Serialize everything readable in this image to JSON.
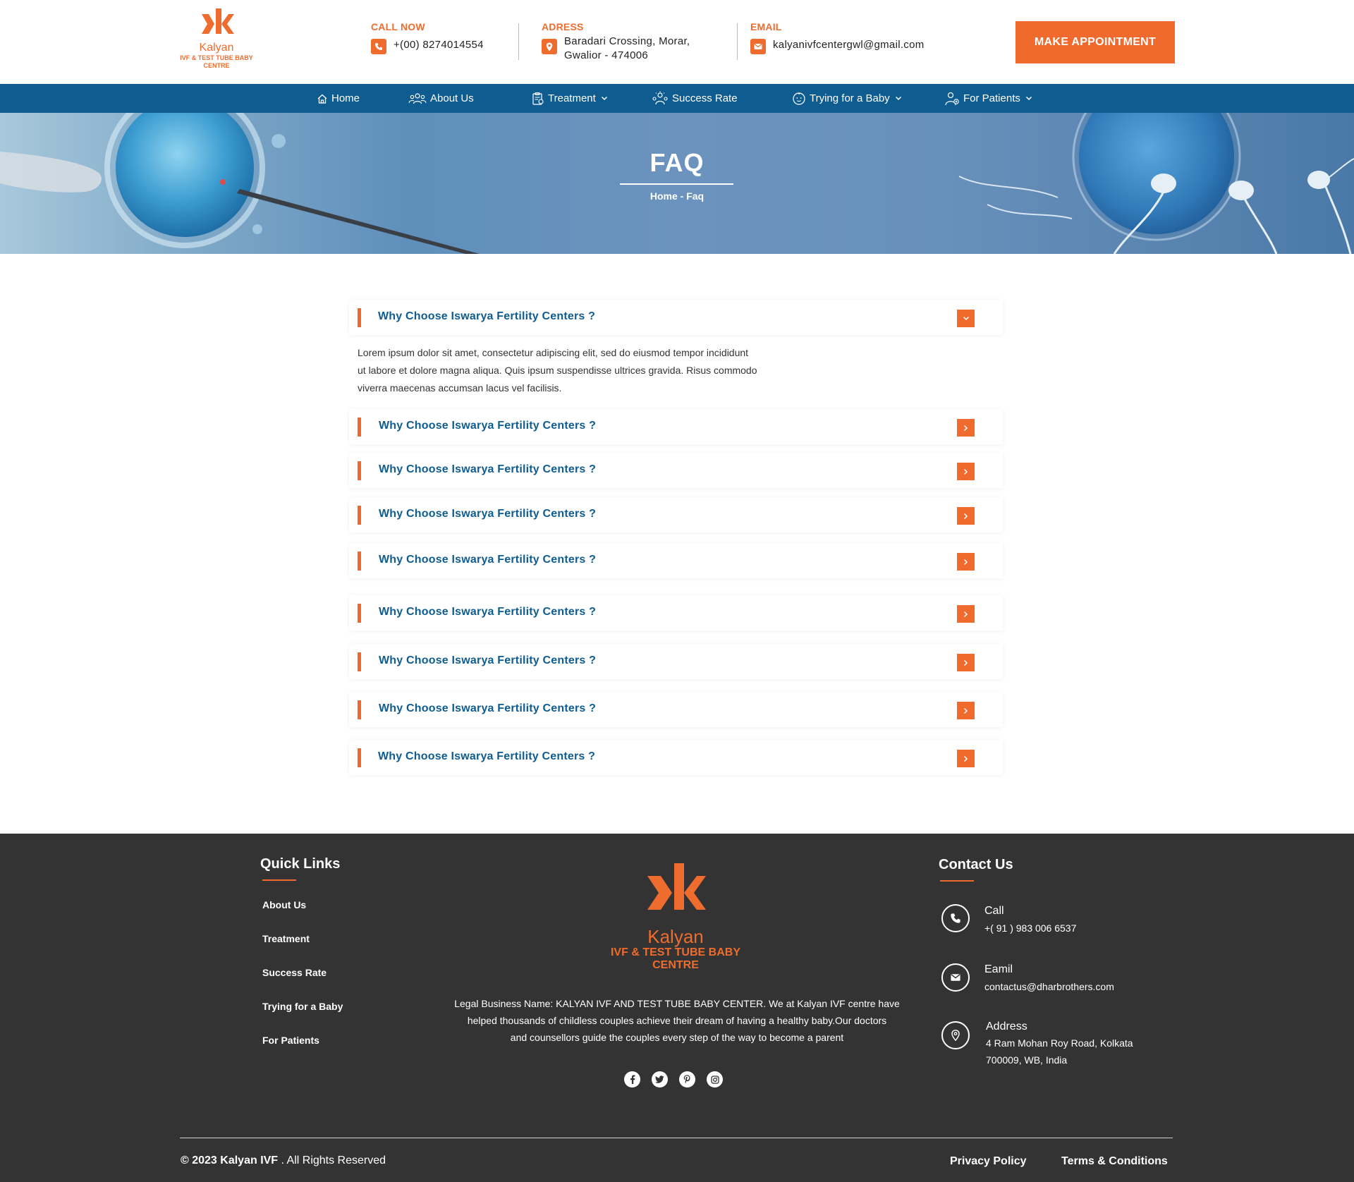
{
  "header": {
    "logo": {
      "brand": "Kalyan",
      "tagline_line1": "IVF & TEST TUBE BABY",
      "tagline_line2": "CENTRE"
    },
    "call": {
      "label": "CALL NOW",
      "value": "+(00) 8274014554"
    },
    "address": {
      "label": "ADRESS",
      "line1": "Baradari Crossing, Morar,",
      "line2": "Gwalior - 474006"
    },
    "email": {
      "label": "EMAIL",
      "value": "kalyanivfcentergwl@gmail.com"
    },
    "appointment_button": "MAKE APPOINTMENT"
  },
  "nav": {
    "items": [
      {
        "label": "Home",
        "icon": "home-icon",
        "has_dropdown": false
      },
      {
        "label": "About Us",
        "icon": "users-icon",
        "has_dropdown": false
      },
      {
        "label": "Treatment",
        "icon": "clipboard-icon",
        "has_dropdown": true
      },
      {
        "label": "Success Rate",
        "icon": "team-icon",
        "has_dropdown": false
      },
      {
        "label": "Trying for a Baby",
        "icon": "baby-icon",
        "has_dropdown": true
      },
      {
        "label": "For Patients",
        "icon": "patient-icon",
        "has_dropdown": true
      }
    ]
  },
  "hero": {
    "title": "FAQ",
    "breadcrumb": "Home - Faq"
  },
  "faq": {
    "items": [
      {
        "question": "Why Choose Iswarya Fertility Centers ?",
        "expanded": true
      },
      {
        "question": "Why Choose Iswarya Fertility Centers ?",
        "expanded": false
      },
      {
        "question": "Why Choose Iswarya Fertility Centers ?",
        "expanded": false
      },
      {
        "question": "Why Choose Iswarya Fertility Centers ?",
        "expanded": false
      },
      {
        "question": "Why Choose Iswarya Fertility Centers ?",
        "expanded": false
      },
      {
        "question": "Why Choose Iswarya Fertility Centers ?",
        "expanded": false
      },
      {
        "question": "Why Choose Iswarya Fertility Centers ?",
        "expanded": false
      },
      {
        "question": "Why Choose Iswarya Fertility Centers ?",
        "expanded": false
      },
      {
        "question": "Why Choose Iswarya Fertility Centers ?",
        "expanded": false
      }
    ],
    "answer_line1": "Lorem ipsum dolor sit amet, consectetur adipiscing elit, sed do eiusmod tempor incididunt",
    "answer_line2": "ut labore et dolore magna aliqua. Quis ipsum suspendisse ultrices gravida. Risus commodo",
    "answer_line3": "viverra maecenas accumsan lacus vel facilisis."
  },
  "footer": {
    "quick_links": {
      "heading": "Quick Links",
      "items": [
        "About Us",
        "Treatment",
        "Success Rate",
        "Trying for a Baby",
        "For Patients"
      ]
    },
    "logo": {
      "brand": "Kalyan",
      "tagline_line1": "IVF & TEST TUBE BABY",
      "tagline_line2": "CENTRE"
    },
    "description_line1": "Legal Business Name: KALYAN IVF AND TEST TUBE BABY CENTER. We at Kalyan IVF centre have",
    "description_line2": "helped thousands of childless couples achieve their dream of having a healthy baby.Our doctors",
    "description_line3": "and counsellors guide the couples every step of the way to become a parent",
    "social_icons": [
      "facebook-icon",
      "twitter-icon",
      "pinterest-icon",
      "instagram-icon"
    ],
    "contact": {
      "heading": "Contact Us",
      "call_title": "Call",
      "call_value": "+( 91 ) 983 006 6537",
      "email_title": "Eamil",
      "email_value": "contactus@dharbrothers.com",
      "address_title": "Address",
      "address_line1": "4 Ram Mohan Roy Road, Kolkata",
      "address_line2": "700009, WB, India"
    },
    "copyright_bold": "© 2023 Kalyan IVF",
    "copyright_rest": " . All Rights Reserved",
    "privacy": "Privacy Policy",
    "terms": "Terms & Conditions"
  },
  "colors": {
    "accent": "#ef6a2c",
    "nav_blue": "#0f5c91",
    "footer_bg": "#333333"
  }
}
